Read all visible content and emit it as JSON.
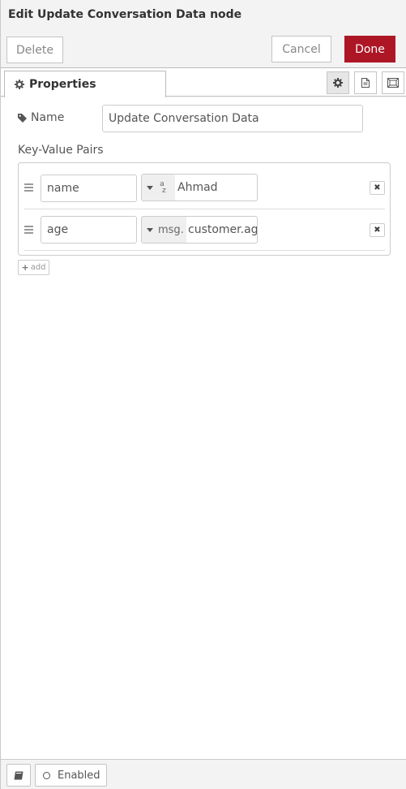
{
  "header": {
    "title": "Edit Update Conversation Data node",
    "delete_label": "Delete",
    "cancel_label": "Cancel",
    "done_label": "Done"
  },
  "tabs": {
    "properties_label": "Properties",
    "icons": [
      "gear-icon",
      "document-icon",
      "frame-icon"
    ]
  },
  "form": {
    "name_label": "Name",
    "name_value": "Update Conversation Data",
    "kv_label": "Key-Value Pairs",
    "pairs": [
      {
        "key": "name",
        "type_prefix": "",
        "type_icon": "string-type-icon",
        "value": "Ahmad"
      },
      {
        "key": "age",
        "type_prefix": "msg.",
        "type_icon": "msg-type",
        "value": "customer.age"
      }
    ],
    "add_label": "add"
  },
  "footer": {
    "enabled_label": "Enabled"
  },
  "colors": {
    "accent": "#ad1625",
    "header_bg": "#f3f3f3"
  }
}
